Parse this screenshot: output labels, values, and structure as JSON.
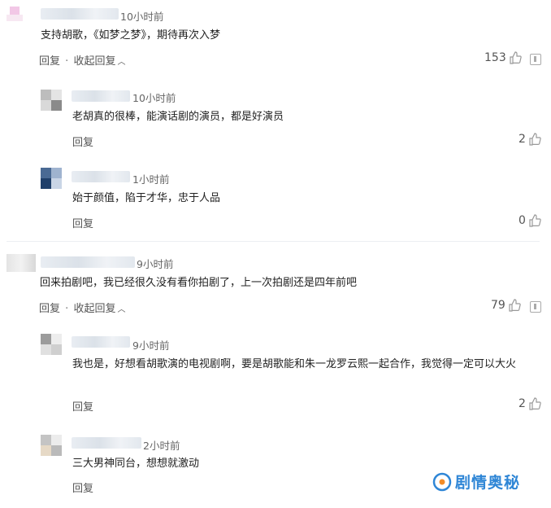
{
  "comments": [
    {
      "time": "10小时前",
      "text": "支持胡歌，《如梦之梦》，期待再次入梦",
      "reply_label": "回复",
      "separator": "·",
      "collapse_label": "收起回复",
      "likes": "153",
      "replies": [
        {
          "time": "10小时前",
          "text": "老胡真的很棒，能演话剧的演员，都是好演员",
          "reply_label": "回复",
          "likes": "2"
        },
        {
          "time": "1小时前",
          "text": "始于颜值，陷于才华，忠于人品",
          "reply_label": "回复",
          "likes": "0"
        }
      ]
    },
    {
      "time": "9小时前",
      "text": "回来拍剧吧，我已经很久没有看你拍剧了，上一次拍剧还是四年前吧",
      "reply_label": "回复",
      "separator": "·",
      "collapse_label": "收起回复",
      "likes": "79",
      "replies": [
        {
          "time": "9小时前",
          "text": "我也是，好想看胡歌演的电视剧啊，要是胡歌能和朱一龙罗云熙一起合作，我觉得一定可以大火",
          "reply_label": "回复",
          "likes": "2"
        },
        {
          "time": "2小时前",
          "text": "三大男神同台，想想就激动",
          "reply_label": "回复",
          "likes": ""
        }
      ]
    }
  ],
  "watermark": {
    "text": "剧情奥秘"
  },
  "colors": {
    "accent": "#2f86d6",
    "text": "#222222",
    "muted": "#666666",
    "divider": "#eceff3"
  }
}
